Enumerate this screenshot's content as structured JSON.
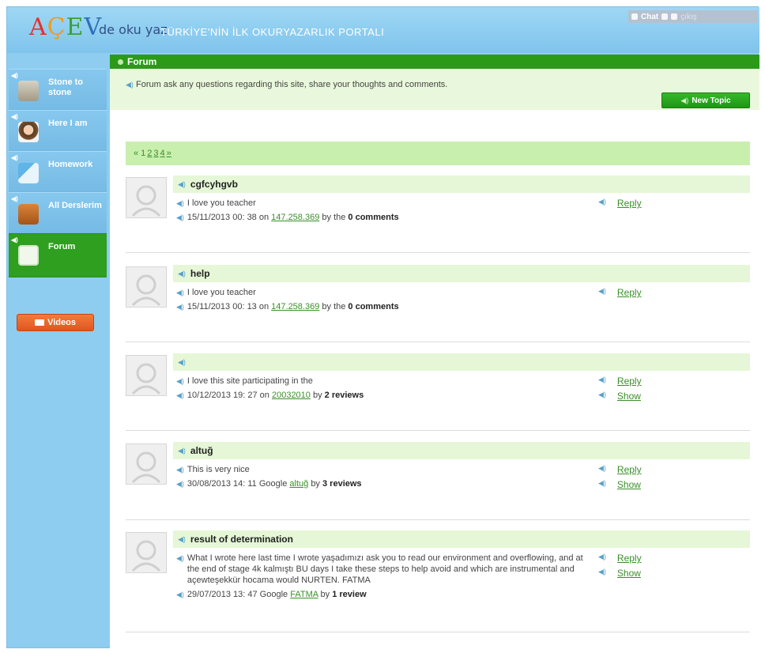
{
  "header": {
    "logo_a": "A",
    "logo_c": "Ç",
    "logo_e": "E",
    "logo_v": "V",
    "logo_tag": "de oku yaz",
    "portal_title": "TÜRKİYE'NİN İLK OKURYAZARLIK PORTALI",
    "chat_label": "Chat",
    "chat_extra": "çıkış"
  },
  "sidebar": {
    "items": [
      {
        "label": "Stone to stone",
        "icon": "stones-icon"
      },
      {
        "label": "Here I am",
        "icon": "children-icon"
      },
      {
        "label": "Homework",
        "icon": "notebook-icon"
      },
      {
        "label": "All Derslerim",
        "icon": "school-bag-icon"
      },
      {
        "label": "Forum",
        "icon": "forum-icon",
        "active": true
      }
    ],
    "videos_label": "Videos"
  },
  "main": {
    "section_title": "Forum",
    "intro": "Forum ask any questions regarding this site, share your thoughts and comments.",
    "new_topic_label": "New Topic",
    "pager": {
      "prefix": "« 1",
      "pages": [
        "2",
        "3",
        "4",
        "»"
      ]
    },
    "topics": [
      {
        "title": "cgfcyhgvb",
        "message": "I love you teacher",
        "meta_date": "15/11/2013 00: 38 on",
        "meta_link": "147.258.369",
        "meta_by": "by the",
        "meta_count": "0 comments",
        "actions": [
          "Reply"
        ]
      },
      {
        "title": "help",
        "message": "I love you teacher",
        "meta_date": "15/11/2013 00: 13 on",
        "meta_link": "147.258.369",
        "meta_by": "by the",
        "meta_count": "0 comments",
        "actions": [
          "Reply"
        ]
      },
      {
        "title": "",
        "message": "I love this site participating in the",
        "meta_date": "10/12/2013 19: 27 on",
        "meta_link": "20032010",
        "meta_by": "by",
        "meta_count": "2 reviews",
        "actions": [
          "Reply",
          "Show"
        ]
      },
      {
        "title": "altuğ",
        "message": "This is very nice",
        "meta_date": "30/08/2013 14: 11 Google",
        "meta_link": "altuğ",
        "meta_by": "by",
        "meta_count": "3 reviews",
        "actions": [
          "Reply",
          "Show"
        ]
      },
      {
        "title": "result of determination",
        "message": "What I wrote here last time I wrote yaşadımızı ask you to read our environment and overflowing, and at the end of stage 4k kalmıştı BU days I take these steps to help avoid and which are instrumental and açewteşekkür hocama would NURTEN. FATMA",
        "meta_date": "29/07/2013 13: 47 Google",
        "meta_link": "FATMA",
        "meta_by": "by",
        "meta_count": "1 review",
        "actions": [
          "Reply",
          "Show"
        ]
      }
    ]
  },
  "colors": {
    "sidebar_bg": "#8ecdf0",
    "accent_green": "#2a9a17",
    "link_green": "#3a8f2a",
    "header_row": "#e5f7d6",
    "videos_orange": "#e9622a"
  }
}
